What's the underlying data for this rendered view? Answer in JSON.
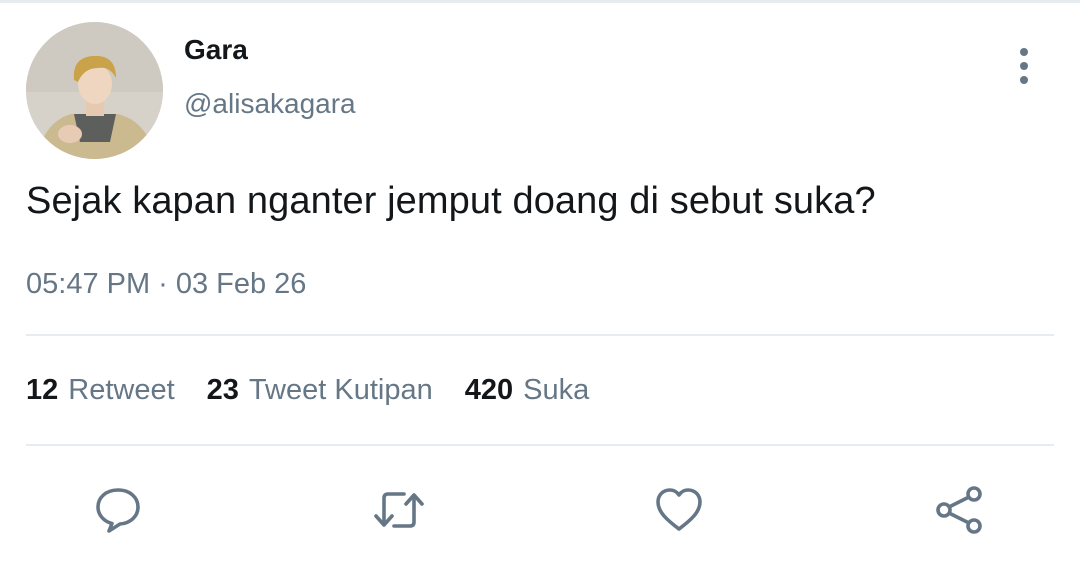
{
  "user": {
    "display_name": "Gara",
    "handle": "@alisakagara"
  },
  "tweet": {
    "text": "Sejak kapan nganter jemput doang di sebut suka?",
    "time": "05:47 PM",
    "separator": "·",
    "date": "03 Feb 26"
  },
  "stats": {
    "retweets": {
      "count": "12",
      "label": "Retweet"
    },
    "quotes": {
      "count": "23",
      "label": "Tweet Kutipan"
    },
    "likes": {
      "count": "420",
      "label": "Suka"
    }
  },
  "icons": {
    "more": "more-vertical-icon",
    "reply": "reply-icon",
    "retweet": "retweet-icon",
    "like": "heart-icon",
    "share": "share-icon"
  },
  "colors": {
    "text_primary": "#14171a",
    "text_secondary": "#657786",
    "divider": "#e6ecf0",
    "icon": "#657786"
  }
}
